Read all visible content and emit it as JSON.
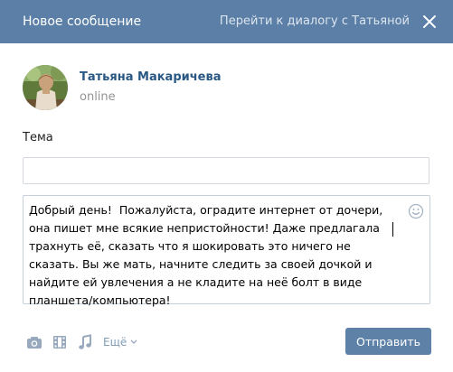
{
  "header": {
    "title": "Новое сообщение",
    "goto_dialog": "Перейти к диалогу с Татьяной"
  },
  "recipient": {
    "name": "Татьяна Макаричева",
    "status": "online"
  },
  "subject": {
    "label": "Тема",
    "value": ""
  },
  "message": {
    "text": "Добрый день!  Пожалуйста, оградите интернет от дочери, она пишет мне всякие непристойности! Даже предлагала трахнуть её, сказать что я шокировать это ничего не сказать. Вы же мать, начните следить за своей дочкой и найдите ей увлечения а не кладите на неё болт в виде планшета/компьютера!"
  },
  "attachments": {
    "icons": [
      "camera-icon",
      "video-icon",
      "music-icon"
    ],
    "more_label": "Ещё"
  },
  "actions": {
    "send_label": "Отправить"
  },
  "colors": {
    "header_bg": "#5b7fa6",
    "name_link": "#2a5885",
    "send_button": "#5e81a8"
  }
}
